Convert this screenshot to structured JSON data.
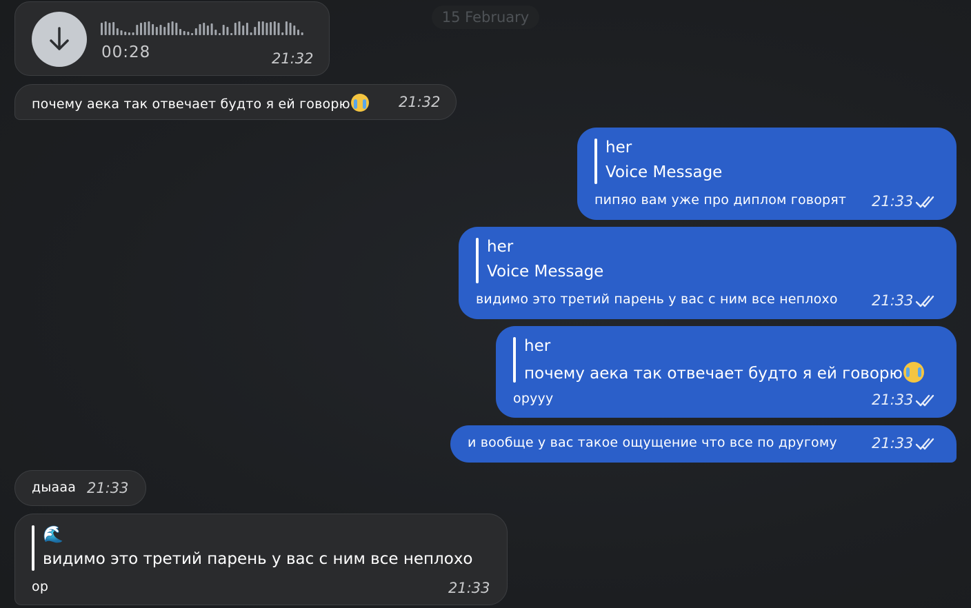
{
  "date_label": "15 February",
  "voice_message": {
    "duration": "00:28",
    "time": "21:32"
  },
  "messages": [
    {
      "text": "почему аека так отвечает будто я ей говорю",
      "time": "21:32"
    },
    {
      "reply_author": "her",
      "reply_text": "Voice Message",
      "text": "пипяо вам уже про диплом говорят",
      "time": "21:33"
    },
    {
      "reply_author": "her",
      "reply_text": "Voice Message",
      "text": "видимо это третий парень у вас с ним все неплохо",
      "time": "21:33"
    },
    {
      "reply_author": "her",
      "reply_text": "почему аека так отвечает будто я ей говорю",
      "text": "оруyy",
      "time": "21:33"
    },
    {
      "text": "и вообще у вас такое ощущение что все по другому",
      "time": "21:33"
    },
    {
      "text": "дыааа",
      "time": "21:33"
    },
    {
      "reply_author_emoji": "🌊",
      "reply_text": "видимо это третий парень у вас с ним все неплохо",
      "text": "ор",
      "time": "21:33"
    }
  ],
  "icons": {
    "download": "download-arrow-icon",
    "read": "double-check-icon",
    "emoji": "loudly-crying-face-emoji"
  },
  "colors": {
    "outgoing": "#2b5fc9",
    "incoming": "#2a2b2d",
    "background": "#1c1e20"
  }
}
